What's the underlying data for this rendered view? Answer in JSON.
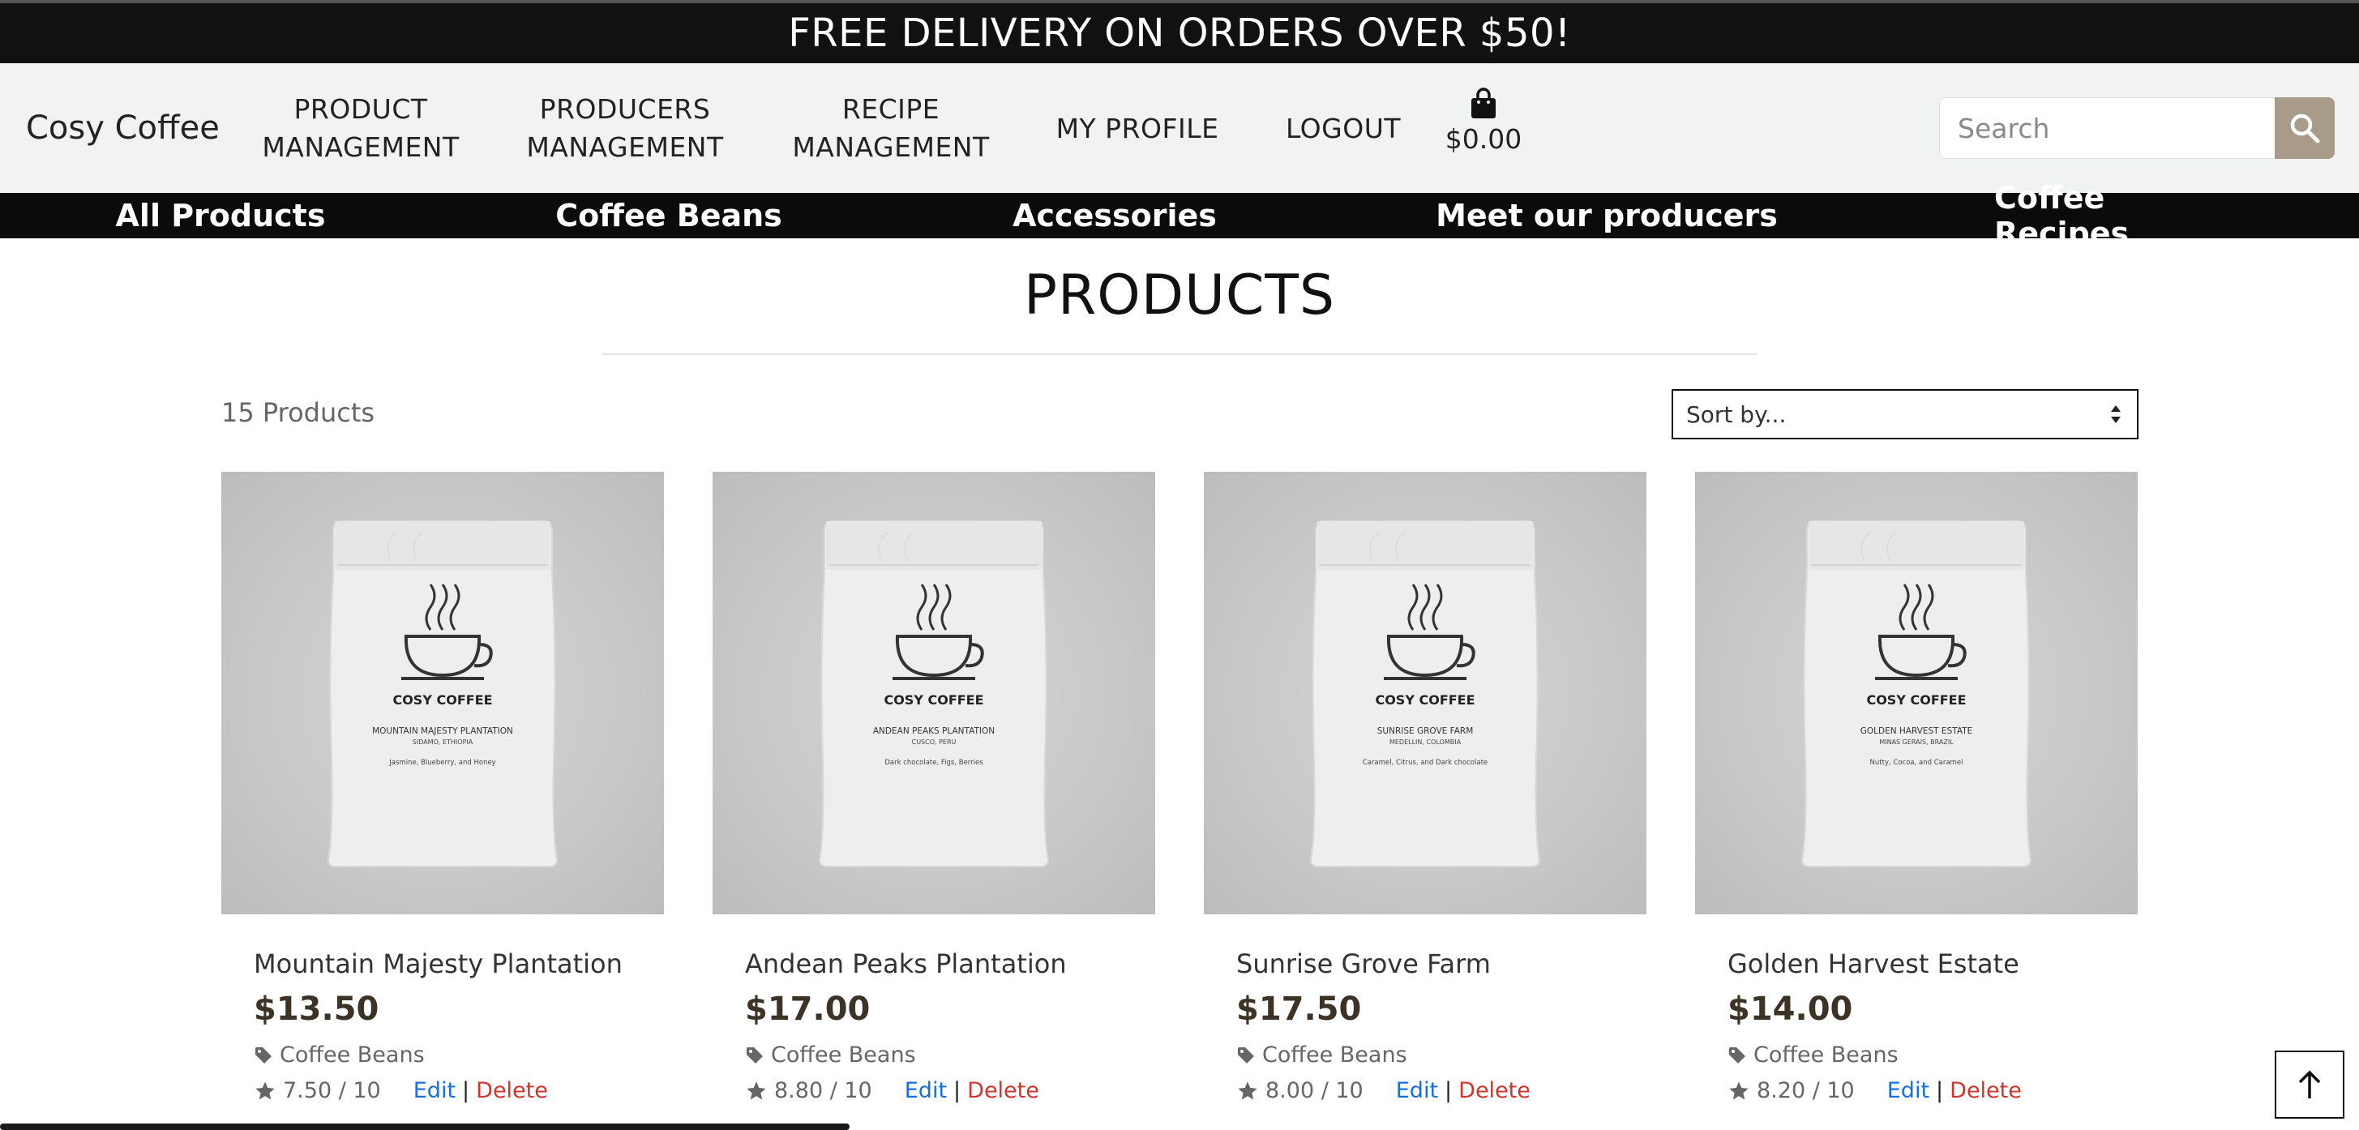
{
  "banner": {
    "text": "FREE DELIVERY ON ORDERS OVER $50!"
  },
  "header": {
    "brand": "Cosy Coffee",
    "nav": [
      {
        "line1": "PRODUCT",
        "line2": "MANAGEMENT"
      },
      {
        "line1": "PRODUCERS",
        "line2": "MANAGEMENT"
      },
      {
        "line1": "RECIPE",
        "line2": "MANAGEMENT"
      },
      {
        "line1": "MY PROFILE",
        "line2": ""
      },
      {
        "line1": "LOGOUT",
        "line2": ""
      }
    ],
    "bag_total": "$0.00",
    "search_placeholder": "Search"
  },
  "categories": [
    "All Products",
    "Coffee Beans",
    "Accessories",
    "Meet our producers",
    "Coffee Recipes"
  ],
  "main": {
    "title": "PRODUCTS",
    "count": "15 Products",
    "sort_label": "Sort by..."
  },
  "products": [
    {
      "name": "Mountain Majesty Plantation",
      "price": "$13.50",
      "category": "Coffee Beans",
      "rating": "7.50 / 10",
      "pkg_brand": "COSY COFFEE",
      "pkg_origin": "MOUNTAIN MAJESTY PLANTATION",
      "pkg_location": "SIDAMO, ETHIOPIA",
      "pkg_notes": "Jasmine, Blueberry, and Honey"
    },
    {
      "name": "Andean Peaks Plantation",
      "price": "$17.00",
      "category": "Coffee Beans",
      "rating": "8.80 / 10",
      "pkg_brand": "COSY COFFEE",
      "pkg_origin": "ANDEAN PEAKS PLANTATION",
      "pkg_location": "CUSCO, PERU",
      "pkg_notes": "Dark chocolate, Figs, Berries"
    },
    {
      "name": "Sunrise Grove Farm",
      "price": "$17.50",
      "category": "Coffee Beans",
      "rating": "8.00 / 10",
      "pkg_brand": "COSY COFFEE",
      "pkg_origin": "SUNRISE GROVE FARM",
      "pkg_location": "MEDELLIN, COLOMBIA",
      "pkg_notes": "Caramel, Citrus, and Dark chocolate"
    },
    {
      "name": "Golden Harvest Estate",
      "price": "$14.00",
      "category": "Coffee Beans",
      "rating": "8.20 / 10",
      "pkg_brand": "COSY COFFEE",
      "pkg_origin": "GOLDEN HARVEST ESTATE",
      "pkg_location": "MINAS GERAIS, BRAZIL",
      "pkg_notes": "Nutty, Cocoa, and Caramel"
    }
  ],
  "actions": {
    "edit": "Edit",
    "separator": "|",
    "delete": "Delete"
  }
}
